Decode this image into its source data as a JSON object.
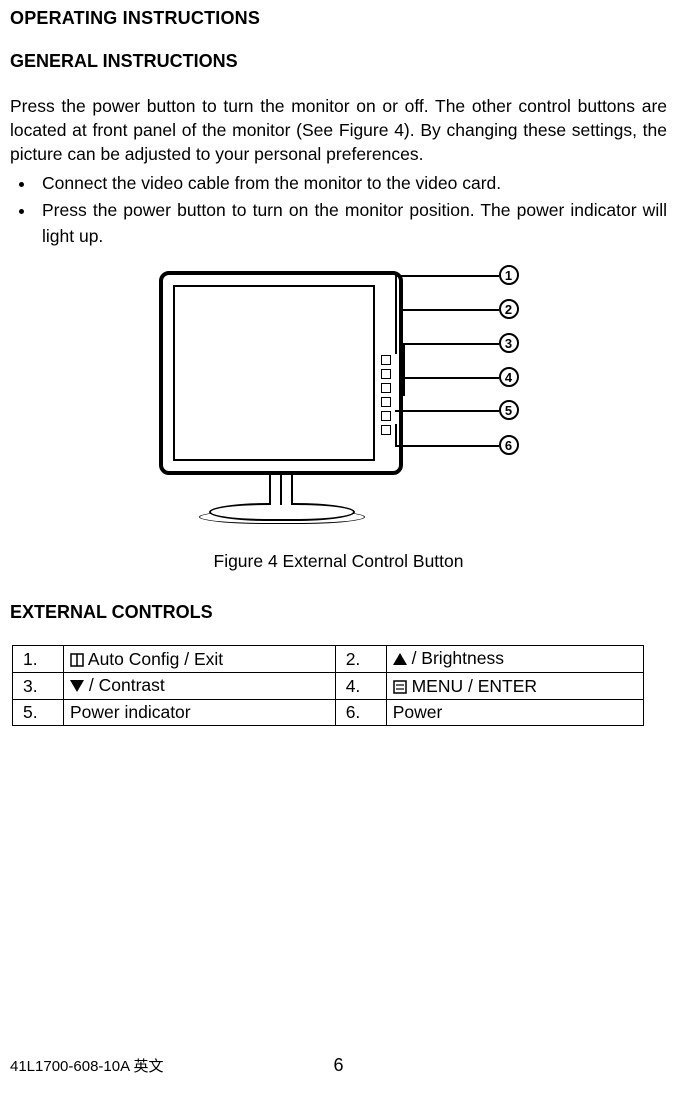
{
  "headings": {
    "h1": "OPERATING INSTRUCTIONS",
    "h2": "GENERAL INSTRUCTIONS",
    "h3": "EXTERNAL CONTROLS"
  },
  "paragraph": "Press the power button to turn the monitor on or off. The other control buttons are located at front panel of the monitor (See Figure 4). By changing these settings, the picture can be adjusted to your personal preferences.",
  "bullets": [
    "Connect the video cable from the monitor to the video card.",
    "Press the power button to turn on the monitor position. The power indicator will light up."
  ],
  "figure": {
    "caption": "Figure 4     External  Control  Button",
    "callouts": [
      "1",
      "2",
      "3",
      "4",
      "5",
      "6"
    ]
  },
  "controls_table": {
    "rows": [
      {
        "n1": "1.",
        "v1": " Auto Config / Exit",
        "n2": "2.",
        "v2": "/ Brightness",
        "icon1": "auto-adjust-icon",
        "icon2": "triangle-up-icon"
      },
      {
        "n1": "3.",
        "v1": "/ Contrast",
        "n2": "4.",
        "v2": " MENU / ENTER",
        "icon1": "triangle-down-icon",
        "icon2": "menu-icon"
      },
      {
        "n1": "5.",
        "v1": "Power indicator",
        "n2": "6.",
        "v2": "Power",
        "icon1": "",
        "icon2": ""
      }
    ]
  },
  "footer": {
    "model": "41L1700-608-10A 英文",
    "page": "6"
  }
}
